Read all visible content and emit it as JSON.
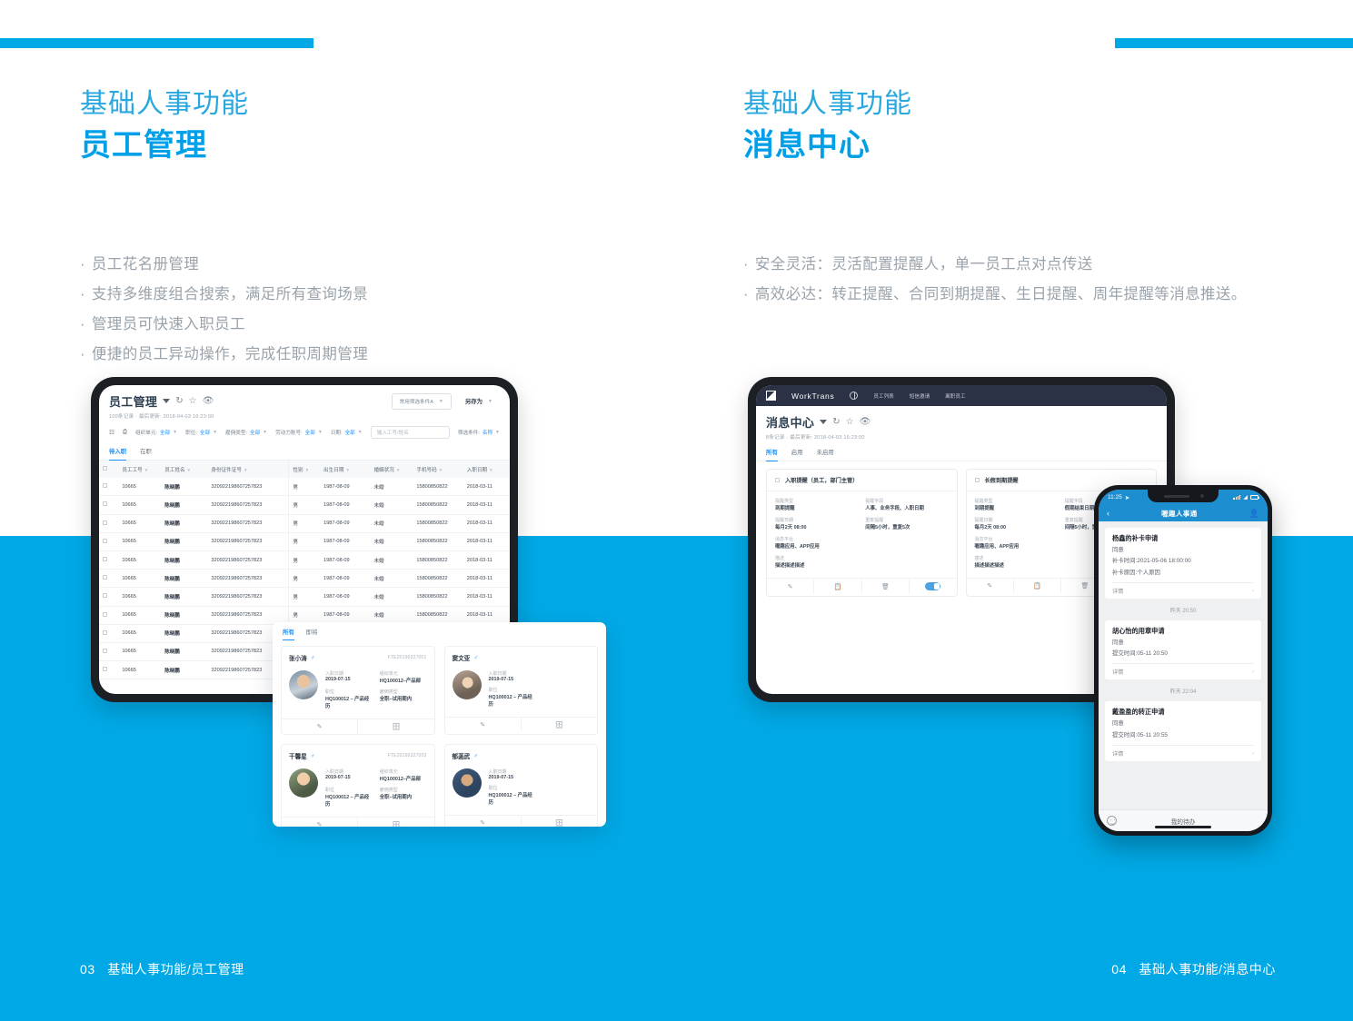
{
  "page": {
    "background_blue": "#00a9e6",
    "accent_blue": "#00a0e9"
  },
  "left_column": {
    "eyebrow": "基础人事功能",
    "headline": "员工管理",
    "bullets": [
      "员工花名册管理",
      "支持多维度组合搜索，满足所有查询场景",
      "管理员可快速入职员工",
      "便捷的员工异动操作，完成任职周期管理"
    ],
    "footer": {
      "number": "03",
      "text": "基础人事功能/员工管理"
    }
  },
  "right_column": {
    "eyebrow": "基础人事功能",
    "headline": "消息中心",
    "bullets": [
      "安全灵活：灵活配置提醒人，单一员工点对点传送",
      "高效必达：转正提醒、合同到期提醒、生日提醒、周年提醒等消息推送。"
    ],
    "footer": {
      "number": "04",
      "text": "基础人事功能/消息中心"
    }
  },
  "employee_app": {
    "title": "员工管理",
    "subtitle": "100条记录 · 最后更新: 2018-04-03 16:23:00",
    "saved_filter": "常用筛选条件A",
    "save_as": "另存为",
    "filters": [
      {
        "label": "组织单元:",
        "value": "全部"
      },
      {
        "label": "职位:",
        "value": "全部"
      },
      {
        "label": "雇佣类型:",
        "value": "全部"
      },
      {
        "label": "劳动力账号:",
        "value": "全部"
      },
      {
        "label": "日期:",
        "value": "全部"
      }
    ],
    "search_placeholder": "输入工号/姓名",
    "filter_condition": {
      "label": "筛选条件:",
      "value": "名称"
    },
    "tabs": [
      {
        "label": "待入职",
        "active": true
      },
      {
        "label": "在职",
        "active": false
      }
    ],
    "columns": [
      "员工工号",
      "员工姓名",
      "身份证件证号",
      "性别",
      "出生日期",
      "婚姻状况",
      "手机号码",
      "入职日期"
    ],
    "rows": [
      [
        "10665",
        "陈晓鹏",
        "320922198607257823",
        "男",
        "1987-08-09",
        "未婚",
        "15800850822",
        "2018-03-11"
      ],
      [
        "10665",
        "陈晓鹏",
        "320922198607257823",
        "男",
        "1987-08-09",
        "未婚",
        "15800850822",
        "2018-03-11"
      ],
      [
        "10665",
        "陈晓鹏",
        "320922198607257823",
        "男",
        "1987-08-09",
        "未婚",
        "15800850822",
        "2018-03-11"
      ],
      [
        "10665",
        "陈晓鹏",
        "320922198607257823",
        "男",
        "1987-08-09",
        "未婚",
        "15800850822",
        "2018-03-11"
      ],
      [
        "10665",
        "陈晓鹏",
        "320922198607257823",
        "男",
        "1987-08-09",
        "未婚",
        "15800850822",
        "2018-03-11"
      ],
      [
        "10665",
        "陈晓鹏",
        "320922198607257823",
        "男",
        "1987-08-09",
        "未婚",
        "15800850822",
        "2018-03-11"
      ],
      [
        "10665",
        "陈晓鹏",
        "320922198607257823",
        "男",
        "1987-08-09",
        "未婚",
        "15800850822",
        "2018-03-11"
      ],
      [
        "10665",
        "陈晓鹏",
        "320922198607257823",
        "男",
        "1987-08-09",
        "未婚",
        "15800850822",
        "2018-03-11"
      ],
      [
        "10665",
        "陈晓鹏",
        "320922198607257823",
        "男",
        "1987-08-09",
        "未婚",
        "15800850822",
        "2018-03-11"
      ],
      [
        "10665",
        "陈晓鹏",
        "320922198607257823",
        "男",
        "1987-08-09",
        "未婚",
        "15800850822",
        "2018-03-11"
      ],
      [
        "10665",
        "陈晓鹏",
        "320922198607257823",
        "男",
        "1987-08-09",
        "未婚",
        "15800850822",
        "2018-03-11"
      ]
    ]
  },
  "cards_panel": {
    "tabs": [
      {
        "label": "所有",
        "active": true
      },
      {
        "label": "即将",
        "active": false
      }
    ],
    "field_labels": {
      "hire_date": "入职日期",
      "org_unit": "组织单元",
      "position": "职位",
      "employment_type": "雇佣类型"
    },
    "cards": [
      {
        "name": "张小涛",
        "gender": "♂",
        "code": "FTE20190327001",
        "hire_date": "2019-07-15",
        "org_unit": "HQ100012–产品部",
        "position": "HQ100012 – 产品经历",
        "employment_type": "全职–试用期内"
      },
      {
        "name": "窦文亚",
        "gender": "♂",
        "code": "",
        "hire_date": "2019-07-15",
        "org_unit": "",
        "position": "HQ100012 – 产品经历",
        "employment_type": ""
      },
      {
        "name": "干馨星",
        "gender": "♂",
        "code": "FTE20190327003",
        "hire_date": "2019-07-15",
        "org_unit": "HQ100012–产品部",
        "position": "HQ100012 – 产品经历",
        "employment_type": "全职–试用期内"
      },
      {
        "name": "郁菡武",
        "gender": "♂",
        "code": "",
        "hire_date": "2019-07-15",
        "org_unit": "",
        "position": "HQ100012 – 产品经历",
        "employment_type": ""
      }
    ]
  },
  "message_app": {
    "brand": "WorkTrans",
    "nav_items": [
      "员工列表",
      "短信邀请",
      "离职员工"
    ],
    "title": "消息中心",
    "subtitle": "8条记录 · 最后更新: 2018-04-03 16:23:00",
    "tabs": [
      {
        "label": "所有",
        "active": true
      },
      {
        "label": "启用",
        "active": false
      },
      {
        "label": "未启用",
        "active": false
      }
    ],
    "field_labels": {
      "remind_type": "提醒类型",
      "remind_field": "提醒字段",
      "remind_date": "提醒日期",
      "repeat_remind": "重复提醒",
      "platform": "消息平台",
      "description": "描述"
    },
    "cards": [
      {
        "title": "入职提醒（员工，部门主管）",
        "remind_type": "到期提醒",
        "remind_field": "人事、业务字段、入职日期",
        "remind_date": "每月2天   08:00",
        "repeat_remind": "间隔5小时，重复5次",
        "platform": "喔趣应用、APP应用",
        "description": "描述描述描述",
        "enabled": true
      },
      {
        "title": "长假到期提醒",
        "remind_type": "到期提醒",
        "remind_field": "假期结束日期",
        "remind_date": "每月2天   08:00",
        "repeat_remind": "间隔5小时，重复5次",
        "platform": "喔趣应用、APP应用",
        "description": "描述描述描述",
        "enabled": false
      }
    ]
  },
  "phone": {
    "status_time": "11:25",
    "nav_title": "喔趣人事通",
    "detail_label": "详情",
    "messages": [
      {
        "stamp": "",
        "title": "杨鑫的补卡申请",
        "lines": [
          "同意",
          "补卡时间:2021-05-06 18:00:00",
          "补卡原因:个人原因"
        ]
      },
      {
        "stamp": "昨天 20:50",
        "title": "胡心怡的用章申请",
        "lines": [
          "同意",
          "提交时间:05-11 20:50"
        ]
      },
      {
        "stamp": "昨天 22:04",
        "title": "戴盈盈的转正申请",
        "lines": [
          "同意",
          "提交时间:05-11 20:55"
        ]
      }
    ],
    "tabbar_label": "我的待办"
  }
}
